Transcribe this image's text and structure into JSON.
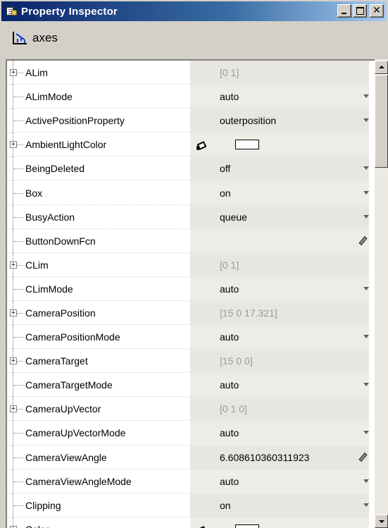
{
  "window": {
    "title": "Property Inspector"
  },
  "object": {
    "label": "axes",
    "icon": "axes-icon"
  },
  "properties": [
    {
      "name": "ALim",
      "value": "[0 1]",
      "kind": "readonly",
      "expandable": true
    },
    {
      "name": "ALimMode",
      "value": "auto",
      "kind": "dropdown",
      "expandable": false
    },
    {
      "name": "ActivePositionProperty",
      "value": "outerposition",
      "kind": "dropdown",
      "expandable": false
    },
    {
      "name": "AmbientLightColor",
      "value": "",
      "kind": "color",
      "swatch": "#ffffff",
      "expandable": true
    },
    {
      "name": "BeingDeleted",
      "value": "off",
      "kind": "dropdown",
      "expandable": false
    },
    {
      "name": "Box",
      "value": "on",
      "kind": "dropdown",
      "expandable": false
    },
    {
      "name": "BusyAction",
      "value": "queue",
      "kind": "dropdown",
      "expandable": false
    },
    {
      "name": "ButtonDownFcn",
      "value": "",
      "kind": "edit",
      "expandable": false
    },
    {
      "name": "CLim",
      "value": "[0 1]",
      "kind": "readonly",
      "expandable": true
    },
    {
      "name": "CLimMode",
      "value": "auto",
      "kind": "dropdown",
      "expandable": false
    },
    {
      "name": "CameraPosition",
      "value": "[15 0 17.321]",
      "kind": "readonly",
      "expandable": true
    },
    {
      "name": "CameraPositionMode",
      "value": "auto",
      "kind": "dropdown",
      "expandable": false
    },
    {
      "name": "CameraTarget",
      "value": "[15 0 0]",
      "kind": "readonly",
      "expandable": true
    },
    {
      "name": "CameraTargetMode",
      "value": "auto",
      "kind": "dropdown",
      "expandable": false
    },
    {
      "name": "CameraUpVector",
      "value": "[0 1 0]",
      "kind": "readonly",
      "expandable": true
    },
    {
      "name": "CameraUpVectorMode",
      "value": "auto",
      "kind": "dropdown",
      "expandable": false
    },
    {
      "name": "CameraViewAngle",
      "value": "6.608610360311923",
      "kind": "edit",
      "expandable": false
    },
    {
      "name": "CameraViewAngleMode",
      "value": "auto",
      "kind": "dropdown",
      "expandable": false
    },
    {
      "name": "Clipping",
      "value": "on",
      "kind": "dropdown",
      "expandable": false
    },
    {
      "name": "Color",
      "value": "",
      "kind": "color",
      "swatch": "#ffffff",
      "expandable": true
    }
  ]
}
